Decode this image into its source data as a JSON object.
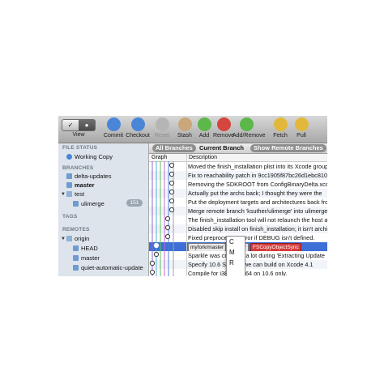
{
  "toolbar": {
    "view_label": "View",
    "buttons": [
      {
        "label": "Commit",
        "icon": "commit-icon",
        "color": "#4a86d8"
      },
      {
        "label": "Checkout",
        "icon": "checkout-icon",
        "color": "#4a86d8"
      },
      {
        "label": "Reset",
        "icon": "reset-icon",
        "color": "#b5b5b5"
      },
      {
        "label": "Stash",
        "icon": "stash-icon",
        "color": "#c9a77a"
      },
      {
        "label": "Add",
        "icon": "add-icon",
        "color": "#5cb84a"
      },
      {
        "label": "Remove",
        "icon": "remove-icon",
        "color": "#d5473c"
      },
      {
        "label": "Add/Remove",
        "icon": "add-remove-icon",
        "color": "#5cb84a"
      },
      {
        "label": "Fetch",
        "icon": "fetch-icon",
        "color": "#e1b83a"
      },
      {
        "label": "Pull",
        "icon": "pull-icon",
        "color": "#e1b83a"
      }
    ]
  },
  "sidebar": {
    "file_status_heading": "FILE STATUS",
    "working_copy": "Working Copy",
    "branches_heading": "BRANCHES",
    "branches": [
      "delta-updates",
      "master"
    ],
    "test_folder": "test",
    "test_child": "ulimerge",
    "test_child_count": "151",
    "tags_heading": "TAGS",
    "remotes_heading": "REMOTES",
    "remote_name": "origin",
    "remote_children": [
      "HEAD",
      "master",
      "quiet-automatic-update"
    ]
  },
  "main": {
    "tab_all": "All Branches",
    "tab_current": "Current Branch",
    "tab_remote": "Show Remote Branches",
    "col_graph": "Graph",
    "col_description": "Description",
    "commits": [
      {
        "desc": "Moved the finish_installation plist into its Xcode group"
      },
      {
        "desc": "Fix to reachability patch in 9cc1905f87bc26d1ebc8102e"
      },
      {
        "desc": "Removing the SDKROOT from ConfigBinaryDelta.xcconfig"
      },
      {
        "desc": "Actually put the archs back; I thought they were the"
      },
      {
        "desc": "Put the deployment targets and architectures back from t"
      },
      {
        "desc": "Merge remote branch 'ksuther/ulimerge' into ulimerge"
      },
      {
        "desc": "The finish_installation tool will not relaunch the host app"
      },
      {
        "desc": "Disabled skip install on finish_installation; it isn't archi"
      },
      {
        "desc": "Fixed preprocessor error if DEBUG isn't defined."
      },
      {
        "labels": [
          "myfork/master",
          "master",
          "FSCopyObjectSync"
        ],
        "desc": ""
      },
      {
        "desc": "Sparkle was crashing a lot during 'Extracting Update"
      },
      {
        "desc": "Specify 10.6 SDK so we can build on Xcode 4.1"
      },
      {
        "desc": "Compile for i386/x86_64 on 10.6 only."
      }
    ]
  },
  "popup": {
    "line1": "C",
    "line2": "M",
    "line3": "R"
  }
}
